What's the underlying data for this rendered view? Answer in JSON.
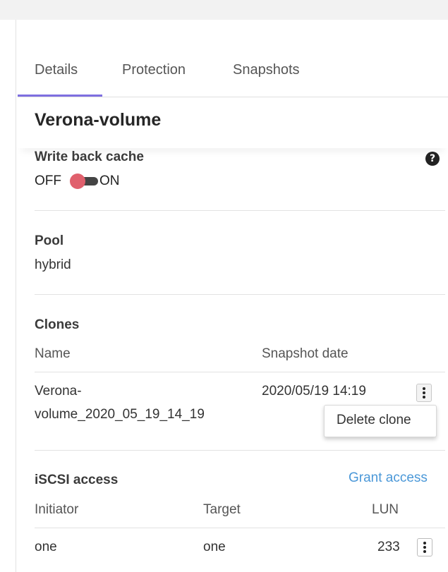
{
  "tabs": [
    {
      "label": "Details"
    },
    {
      "label": "Protection"
    },
    {
      "label": "Snapshots"
    }
  ],
  "active_tab_color": "#7e6fe0",
  "volume": {
    "title": "Verona-volume"
  },
  "write_back_cache": {
    "label": "Write back cache",
    "off_label": "OFF",
    "on_label": "ON",
    "help_icon": "question-circle-icon",
    "help_glyph": "?",
    "toggle_color": "#e0606d"
  },
  "pool": {
    "label": "Pool",
    "value": "hybrid"
  },
  "clones": {
    "label": "Clones",
    "columns": [
      "Name",
      "Snapshot date"
    ],
    "rows": [
      {
        "name_line1": "Verona-",
        "name_line2": "volume_2020_05_19_14_19",
        "snapshot_date": "2020/05/19 14:19"
      }
    ],
    "menu": {
      "delete_label": "Delete clone"
    }
  },
  "iscsi": {
    "label": "iSCSI access",
    "grant_label": "Grant access",
    "link_color": "#4b98d8",
    "columns": [
      "Initiator",
      "Target",
      "LUN"
    ],
    "rows": [
      {
        "initiator": "one",
        "target": "one",
        "lun": "233"
      }
    ]
  }
}
